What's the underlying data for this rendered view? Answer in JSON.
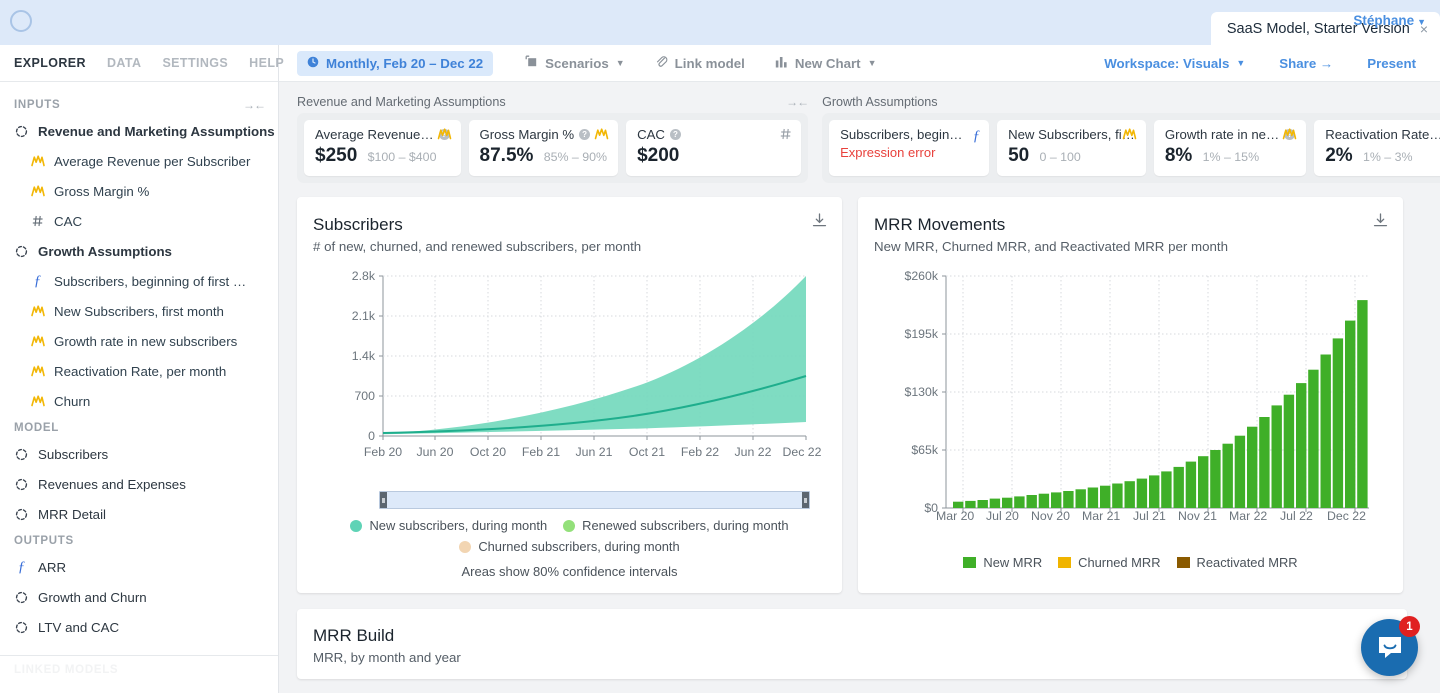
{
  "tabbar": {
    "logo_icon": "circle-logo-icon",
    "tab_title": "SaaS Model, Starter Version",
    "tab_close": "×",
    "user_name": "Stéphane",
    "user_caret": "▼"
  },
  "sidebar": {
    "nav": [
      {
        "label": "EXPLORER",
        "active": true
      },
      {
        "label": "DATA",
        "active": false
      },
      {
        "label": "SETTINGS",
        "active": false
      },
      {
        "label": "HELP",
        "active": false
      }
    ],
    "groups": [
      {
        "header": "INPUTS",
        "collapse_icon": "collapse-arrows-icon",
        "items": [
          {
            "label": "Revenue and Marketing Assumptions",
            "icon": "module-icon",
            "level": "parent"
          },
          {
            "label": "Average Revenue per Subscriber",
            "icon": "distribution-icon",
            "level": "sub"
          },
          {
            "label": "Gross Margin %",
            "icon": "distribution-icon",
            "level": "sub"
          },
          {
            "label": "CAC",
            "icon": "hash-icon",
            "level": "sub"
          },
          {
            "label": "Growth Assumptions",
            "icon": "module-icon",
            "level": "parent"
          },
          {
            "label": "Subscribers, beginning of first …",
            "icon": "formula-icon",
            "level": "sub"
          },
          {
            "label": "New Subscribers, first month",
            "icon": "distribution-icon",
            "level": "sub"
          },
          {
            "label": "Growth rate in new subscribers",
            "icon": "distribution-icon",
            "level": "sub"
          },
          {
            "label": "Reactivation Rate, per month",
            "icon": "distribution-icon",
            "level": "sub"
          },
          {
            "label": "Churn",
            "icon": "distribution-icon",
            "level": "sub"
          }
        ]
      },
      {
        "header": "MODEL",
        "items": [
          {
            "label": "Subscribers",
            "icon": "module-icon",
            "level": "parent-plain"
          },
          {
            "label": "Revenues and Expenses",
            "icon": "module-icon",
            "level": "parent-plain"
          },
          {
            "label": "MRR Detail",
            "icon": "module-icon",
            "level": "parent-plain"
          }
        ]
      },
      {
        "header": "OUTPUTS",
        "items": [
          {
            "label": "ARR",
            "icon": "formula-icon",
            "level": "parent-plain"
          },
          {
            "label": "Growth and Churn",
            "icon": "module-icon",
            "level": "parent-plain"
          },
          {
            "label": "LTV and CAC",
            "icon": "module-icon",
            "level": "parent-plain"
          }
        ]
      }
    ],
    "footer_header": "LINKED MODELS"
  },
  "toolbar": {
    "left": [
      {
        "label": "Monthly, Feb 20 – Dec 22",
        "icon": "clock-icon",
        "caret": "",
        "style": "pill"
      },
      {
        "label": "Scenarios",
        "icon": "copies-icon",
        "caret": "▼",
        "style": "plain"
      },
      {
        "label": "Link model",
        "icon": "paperclip-icon",
        "caret": "",
        "style": "plain"
      },
      {
        "label": "New Chart",
        "icon": "bar-chart-icon",
        "caret": "▼",
        "style": "plain"
      }
    ],
    "right": [
      {
        "label": "Workspace: Visuals",
        "caret": "▼"
      },
      {
        "label": "Share →",
        "caret": ""
      },
      {
        "label": "Present",
        "caret": ""
      }
    ]
  },
  "input_groups": [
    {
      "header": "Revenue and Marketing Assumptions",
      "collapse_icon": "collapse-arrows-icon",
      "cards": [
        {
          "title": "Average Revenue…",
          "has_help": true,
          "icon": "distribution-icon",
          "value": "$250",
          "range": "$100 – $400",
          "error": ""
        },
        {
          "title": "Gross Margin %",
          "has_help": true,
          "icon": "distribution-icon",
          "value": "87.5%",
          "range": "85% – 90%",
          "error": ""
        },
        {
          "title": "CAC",
          "has_help": true,
          "icon": "hash-icon",
          "value": "$200",
          "range": "",
          "error": ""
        }
      ]
    },
    {
      "header": "Growth Assumptions",
      "collapse_icon": "",
      "cards": [
        {
          "title": "Subscribers, begin…",
          "has_help": false,
          "icon": "formula-icon",
          "value": "",
          "range": "",
          "error": "Expression error"
        },
        {
          "title": "New Subscribers, fi…",
          "has_help": false,
          "icon": "distribution-icon",
          "value": "50",
          "range": "0 – 100",
          "error": ""
        },
        {
          "title": "Growth rate in ne…",
          "has_help": true,
          "icon": "distribution-icon",
          "value": "8%",
          "range": "1% – 15%",
          "error": ""
        },
        {
          "title": "Reactivation Rate…",
          "has_help": false,
          "icon": "distribution-icon",
          "value": "2%",
          "range": "1% – 3%",
          "error": ""
        }
      ]
    }
  ],
  "charts": [
    {
      "title": "Subscribers",
      "subtitle": "# of new, churned, and renewed subscribers, per month",
      "download_icon": "download-icon",
      "legend": [
        {
          "label": "New subscribers, during month",
          "color": "#5fd3b6",
          "shape": "dot"
        },
        {
          "label": "Renewed subscribers, during month",
          "color": "#93e07a",
          "shape": "dot"
        },
        {
          "label": "Churned subscribers, during month",
          "color": "#f2d5b2",
          "shape": "dot"
        }
      ],
      "note": "Areas show 80% confidence intervals",
      "scrub": {
        "left_handle": "scrub-handle-left",
        "right_handle": "scrub-handle-right"
      }
    },
    {
      "title": "MRR Movements",
      "subtitle": "New MRR, Churned MRR, and Reactivated MRR per month",
      "download_icon": "download-icon",
      "legend": [
        {
          "label": "New MRR",
          "color": "#3faf28",
          "shape": "square"
        },
        {
          "label": "Churned MRR",
          "color": "#f0b400",
          "shape": "square"
        },
        {
          "label": "Reactivated MRR",
          "color": "#8a5a00",
          "shape": "square"
        }
      ]
    }
  ],
  "bottom_chart": {
    "title": "MRR Build",
    "subtitle": "MRR, by month and year"
  },
  "intercom": {
    "icon": "chat-bubble-icon",
    "badge": "1"
  },
  "colors": {
    "accent_blue": "#4a8fe0",
    "pill_bg": "#dae9fb",
    "error_red": "#e8413c",
    "teal": "#3fc9a7",
    "teal_band": "#74d9bd",
    "green_bar": "#3faf28"
  },
  "chart_data": [
    {
      "type": "area",
      "title": "Subscribers",
      "subtitle": "# of new, churned, and renewed subscribers, per month",
      "xlabel": "",
      "ylabel": "",
      "ylim": [
        0,
        2800
      ],
      "yticks": [
        0,
        700,
        1400,
        2100,
        2800
      ],
      "ytick_labels": [
        "0",
        "700",
        "1.4k",
        "2.1k",
        "2.8k"
      ],
      "xtick_labels": [
        "Feb 20",
        "Jun 20",
        "Oct 20",
        "Feb 21",
        "Jun 21",
        "Oct 21",
        "Feb 22",
        "Jun 22",
        "Dec 22"
      ],
      "grid": true,
      "legend_position": "bottom",
      "annotations": [
        "Areas show 80% confidence intervals"
      ],
      "series": [
        {
          "name": "New subscribers, during month",
          "color": "#3fc9a7",
          "x": [
            "Feb 20",
            "Jun 20",
            "Oct 20",
            "Feb 21",
            "Jun 21",
            "Oct 21",
            "Feb 22",
            "Jun 22",
            "Dec 22"
          ],
          "values": [
            50,
            68,
            95,
            140,
            200,
            290,
            430,
            650,
            1030
          ],
          "band_low": [
            48,
            60,
            76,
            100,
            130,
            160,
            190,
            215,
            240
          ],
          "band_high": [
            52,
            80,
            130,
            215,
            370,
            640,
            1130,
            1850,
            2800
          ]
        },
        {
          "name": "Renewed subscribers, during month",
          "color": "#93e07a",
          "values": []
        },
        {
          "name": "Churned subscribers, during month",
          "color": "#f2d5b2",
          "values": []
        }
      ]
    },
    {
      "type": "bar",
      "title": "MRR Movements",
      "subtitle": "New MRR, Churned MRR, and Reactivated MRR per month",
      "xlabel": "",
      "ylabel": "",
      "ylim": [
        0,
        260000
      ],
      "yticks": [
        0,
        65000,
        130000,
        195000,
        260000
      ],
      "ytick_labels": [
        "$0",
        "$65k",
        "$130k",
        "$195k",
        "$260k"
      ],
      "xtick_labels": [
        "Mar 20",
        "Jul 20",
        "Nov 20",
        "Mar 21",
        "Jul 21",
        "Nov 21",
        "Mar 22",
        "Jul 22",
        "Dec 22"
      ],
      "grid": true,
      "legend_position": "bottom",
      "series": [
        {
          "name": "New MRR",
          "color": "#3faf28",
          "categories": [
            "Mar 20",
            "Apr 20",
            "May 20",
            "Jun 20",
            "Jul 20",
            "Aug 20",
            "Sep 20",
            "Oct 20",
            "Nov 20",
            "Dec 20",
            "Jan 21",
            "Feb 21",
            "Mar 21",
            "Apr 21",
            "May 21",
            "Jun 21",
            "Jul 21",
            "Aug 21",
            "Sep 21",
            "Oct 21",
            "Nov 21",
            "Dec 21",
            "Jan 22",
            "Feb 22",
            "Mar 22",
            "Apr 22",
            "May 22",
            "Jun 22",
            "Jul 22",
            "Aug 22",
            "Sep 22",
            "Oct 22",
            "Nov 22",
            "Dec 22"
          ],
          "values": [
            7000,
            8000,
            9000,
            10500,
            11500,
            13000,
            14500,
            16000,
            17500,
            19000,
            21000,
            23000,
            25000,
            27500,
            30000,
            33000,
            36500,
            41000,
            46000,
            52000,
            58000,
            65000,
            72000,
            81000,
            91000,
            102000,
            115000,
            127000,
            140000,
            155000,
            172000,
            190000,
            210000,
            233000
          ]
        },
        {
          "name": "Churned MRR",
          "color": "#f0b400",
          "values": []
        },
        {
          "name": "Reactivated MRR",
          "color": "#8a5a00",
          "values": []
        }
      ]
    }
  ]
}
